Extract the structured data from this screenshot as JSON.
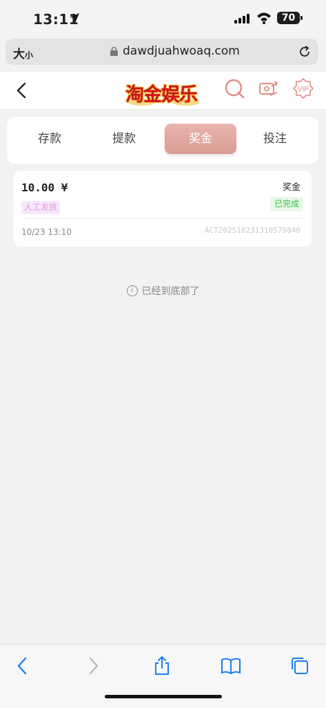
{
  "status_bar": {
    "time": "13:11",
    "battery": "70"
  },
  "browser": {
    "text_size_label": "大",
    "text_size_small": "小",
    "domain": "dawdjuahwoaq.com"
  },
  "header": {
    "logo_text": "淘金娱乐",
    "vip_label": "VIP"
  },
  "tabs": [
    {
      "label": "存款",
      "active": false
    },
    {
      "label": "提款",
      "active": false
    },
    {
      "label": "奖金",
      "active": true
    },
    {
      "label": "投注",
      "active": false
    }
  ],
  "records": [
    {
      "amount": "10.00 ¥",
      "source_tag": "人工发放",
      "type": "奖金",
      "status": "已完成",
      "time": "10/23 13:10",
      "order_id": "ACT202510231310579840"
    }
  ],
  "end_message": "已经到底部了",
  "colors": {
    "accent": "#d99c93",
    "status_done": "#3cba4b",
    "tag_purple": "#e49ad6",
    "ios_blue": "#1a7cf5"
  }
}
